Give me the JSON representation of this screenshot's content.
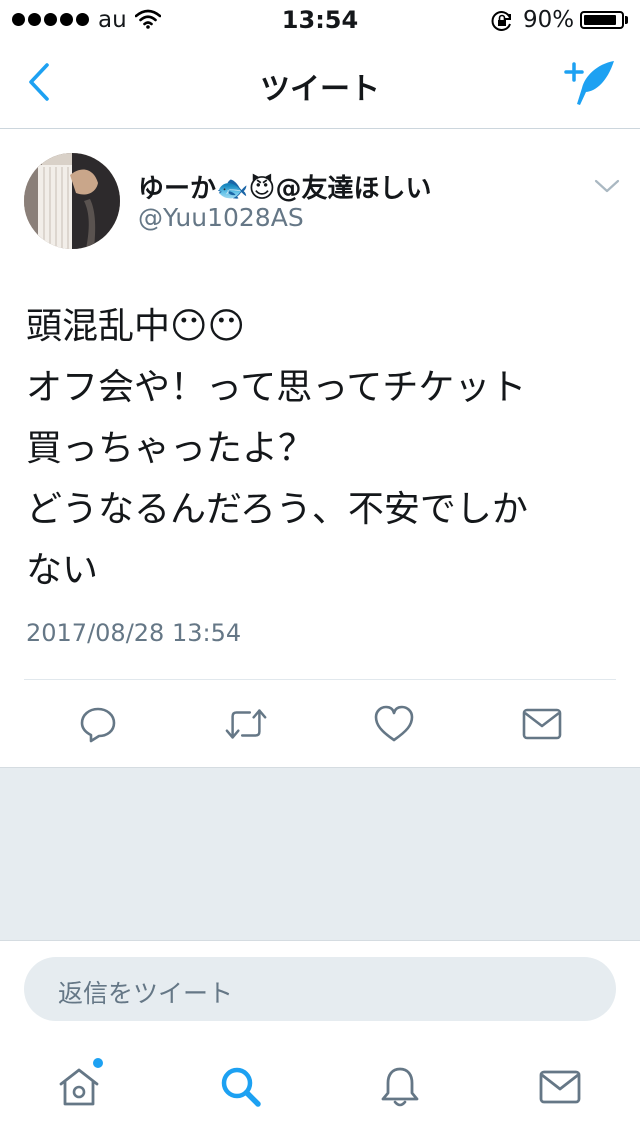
{
  "status_bar": {
    "carrier": "au",
    "time": "13:54",
    "battery_percent": "90%",
    "battery_level": 0.9
  },
  "nav": {
    "title": "ツイート",
    "back_icon": "chevron-left-icon",
    "compose_icon": "compose-tweet-icon"
  },
  "tweet": {
    "display_name": "ゆーか🐟😈@友達ほしい",
    "handle": "@Yuu1028AS",
    "text": "頭混乱中😶😶\nオフ会や！って思ってチケット\n買っちゃったよ？\nどうなるんだろう、不安でしか\nない",
    "timestamp": "2017/08/28 13:54"
  },
  "actions": [
    "reply-icon",
    "retweet-icon",
    "like-icon",
    "direct-message-icon"
  ],
  "reply": {
    "placeholder": "返信をツイート"
  },
  "tab_bar": {
    "active": "search",
    "items": [
      "home-icon",
      "search-icon",
      "notifications-icon",
      "messages-icon"
    ]
  },
  "colors": {
    "accent": "#1da1f2",
    "icon_gray": "#657786",
    "separator": "#e6ecf0"
  }
}
